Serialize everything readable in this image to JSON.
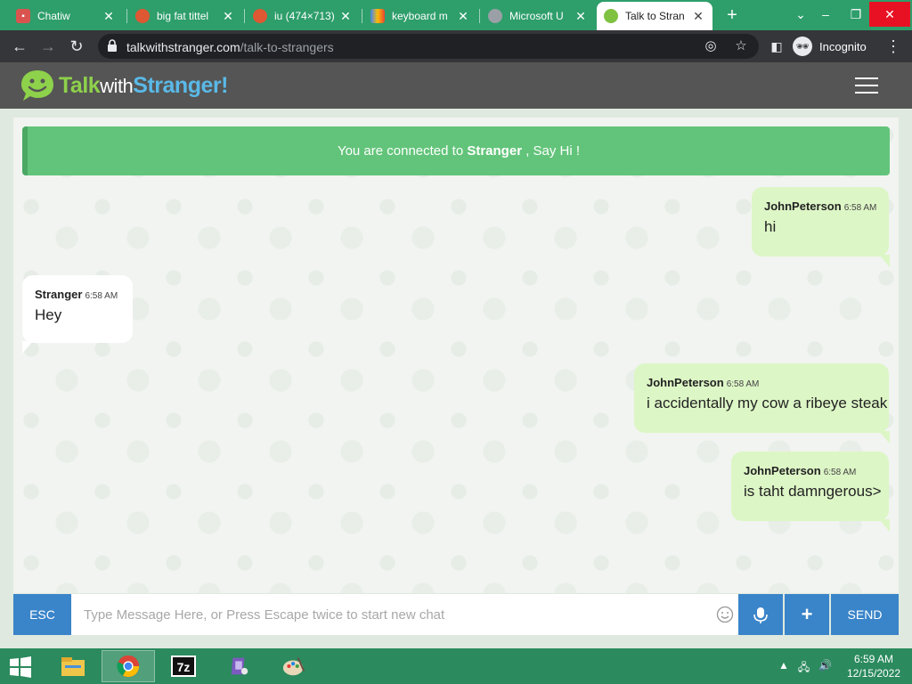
{
  "browser": {
    "tabs": [
      {
        "label": "Chatiw",
        "active": false,
        "favicon_color": "#d9534f"
      },
      {
        "label": "big fat tittel",
        "active": false,
        "favicon_color": "#de5833"
      },
      {
        "label": "iu (474×713)",
        "active": false,
        "favicon_color": "#de5833"
      },
      {
        "label": "keyboard m",
        "active": false,
        "favicon_color": "#4285f4"
      },
      {
        "label": "Microsoft U",
        "active": false,
        "favicon_color": "#9aa0a6"
      },
      {
        "label": "Talk to Stran",
        "active": true,
        "favicon_color": "#7fc241"
      }
    ],
    "url_host": "talkwithstranger.com",
    "url_path": "/talk-to-strangers",
    "incognito_label": "Incognito"
  },
  "site": {
    "brand_part1": "Talk",
    "brand_part2": "with",
    "brand_part3": "Stranger!",
    "colors": {
      "header": "#555555",
      "accent_green": "#8ed14b",
      "accent_blue": "#5ab9e8",
      "button_blue": "#3a84c9",
      "banner_green": "#62c47a"
    }
  },
  "chat": {
    "banner_prefix": "You are connected to",
    "banner_name": "Stranger",
    "banner_suffix": ", Say Hi !",
    "messages": [
      {
        "author": "JohnPeterson",
        "time": "6:58 AM",
        "text": "hi",
        "side": "me"
      },
      {
        "author": "Stranger",
        "time": "6:58 AM",
        "text": "Hey",
        "side": "them"
      },
      {
        "author": "JohnPeterson",
        "time": "6:58 AM",
        "text": "i accidentally my cow a ribeye steak",
        "side": "me"
      },
      {
        "author": "JohnPeterson",
        "time": "6:58 AM",
        "text": "is taht damngerous>",
        "side": "me"
      }
    ]
  },
  "input": {
    "esc_label": "ESC",
    "placeholder": "Type Message Here, or Press Escape twice to start new chat",
    "value": "",
    "send_label": "SEND"
  },
  "taskbar": {
    "time": "6:59 AM",
    "date": "12/15/2022"
  }
}
